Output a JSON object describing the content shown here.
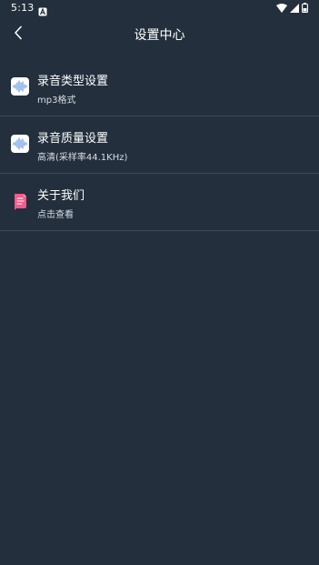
{
  "status_bar": {
    "time": "5:13",
    "app_icon": "a-notification-icon",
    "icons": [
      "wifi-icon",
      "cell-signal-icon",
      "battery-icon"
    ]
  },
  "header": {
    "back_icon": "chevron-left-icon",
    "title": "设置中心"
  },
  "settings": {
    "items": [
      {
        "title": "录音类型设置",
        "subtitle": "mp3格式",
        "icon": "audio-wave-icon"
      },
      {
        "title": "录音质量设置",
        "subtitle": "高清(采样率44.1KHz)",
        "icon": "audio-wave-icon"
      },
      {
        "title": "关于我们",
        "subtitle": "点击查看",
        "icon": "document-icon"
      }
    ]
  },
  "colors": {
    "background": "#232f3d",
    "divider": "#3d4958",
    "accent_blue": "#5a8fe0",
    "accent_pink": "#f25b8a"
  }
}
